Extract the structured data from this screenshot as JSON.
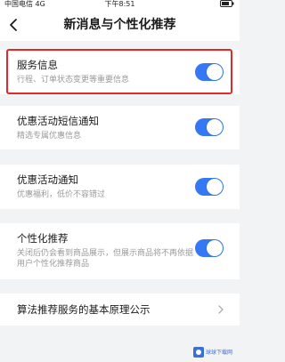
{
  "status_bar": {
    "carrier": "中国电信",
    "network": "4G",
    "time": "下午8:51"
  },
  "header": {
    "title": "新消息与个性化推荐"
  },
  "settings": [
    {
      "title": "服务信息",
      "desc": "行程、订单状态变更等重要信息",
      "enabled": true
    },
    {
      "title": "优惠活动短信通知",
      "desc": "精选专属优惠信息",
      "enabled": true
    },
    {
      "title": "优惠活动通知",
      "desc": "优惠福利，低价不容错过",
      "enabled": true
    },
    {
      "title": "个性化推荐",
      "desc": "关闭后仍会看到商品展示，但展示商品将不再依据用户个性化推荐商品",
      "enabled": true
    }
  ],
  "link_row": {
    "label": "算法推荐服务的基本原理公示"
  },
  "watermark": {
    "text": "球球下载网"
  }
}
